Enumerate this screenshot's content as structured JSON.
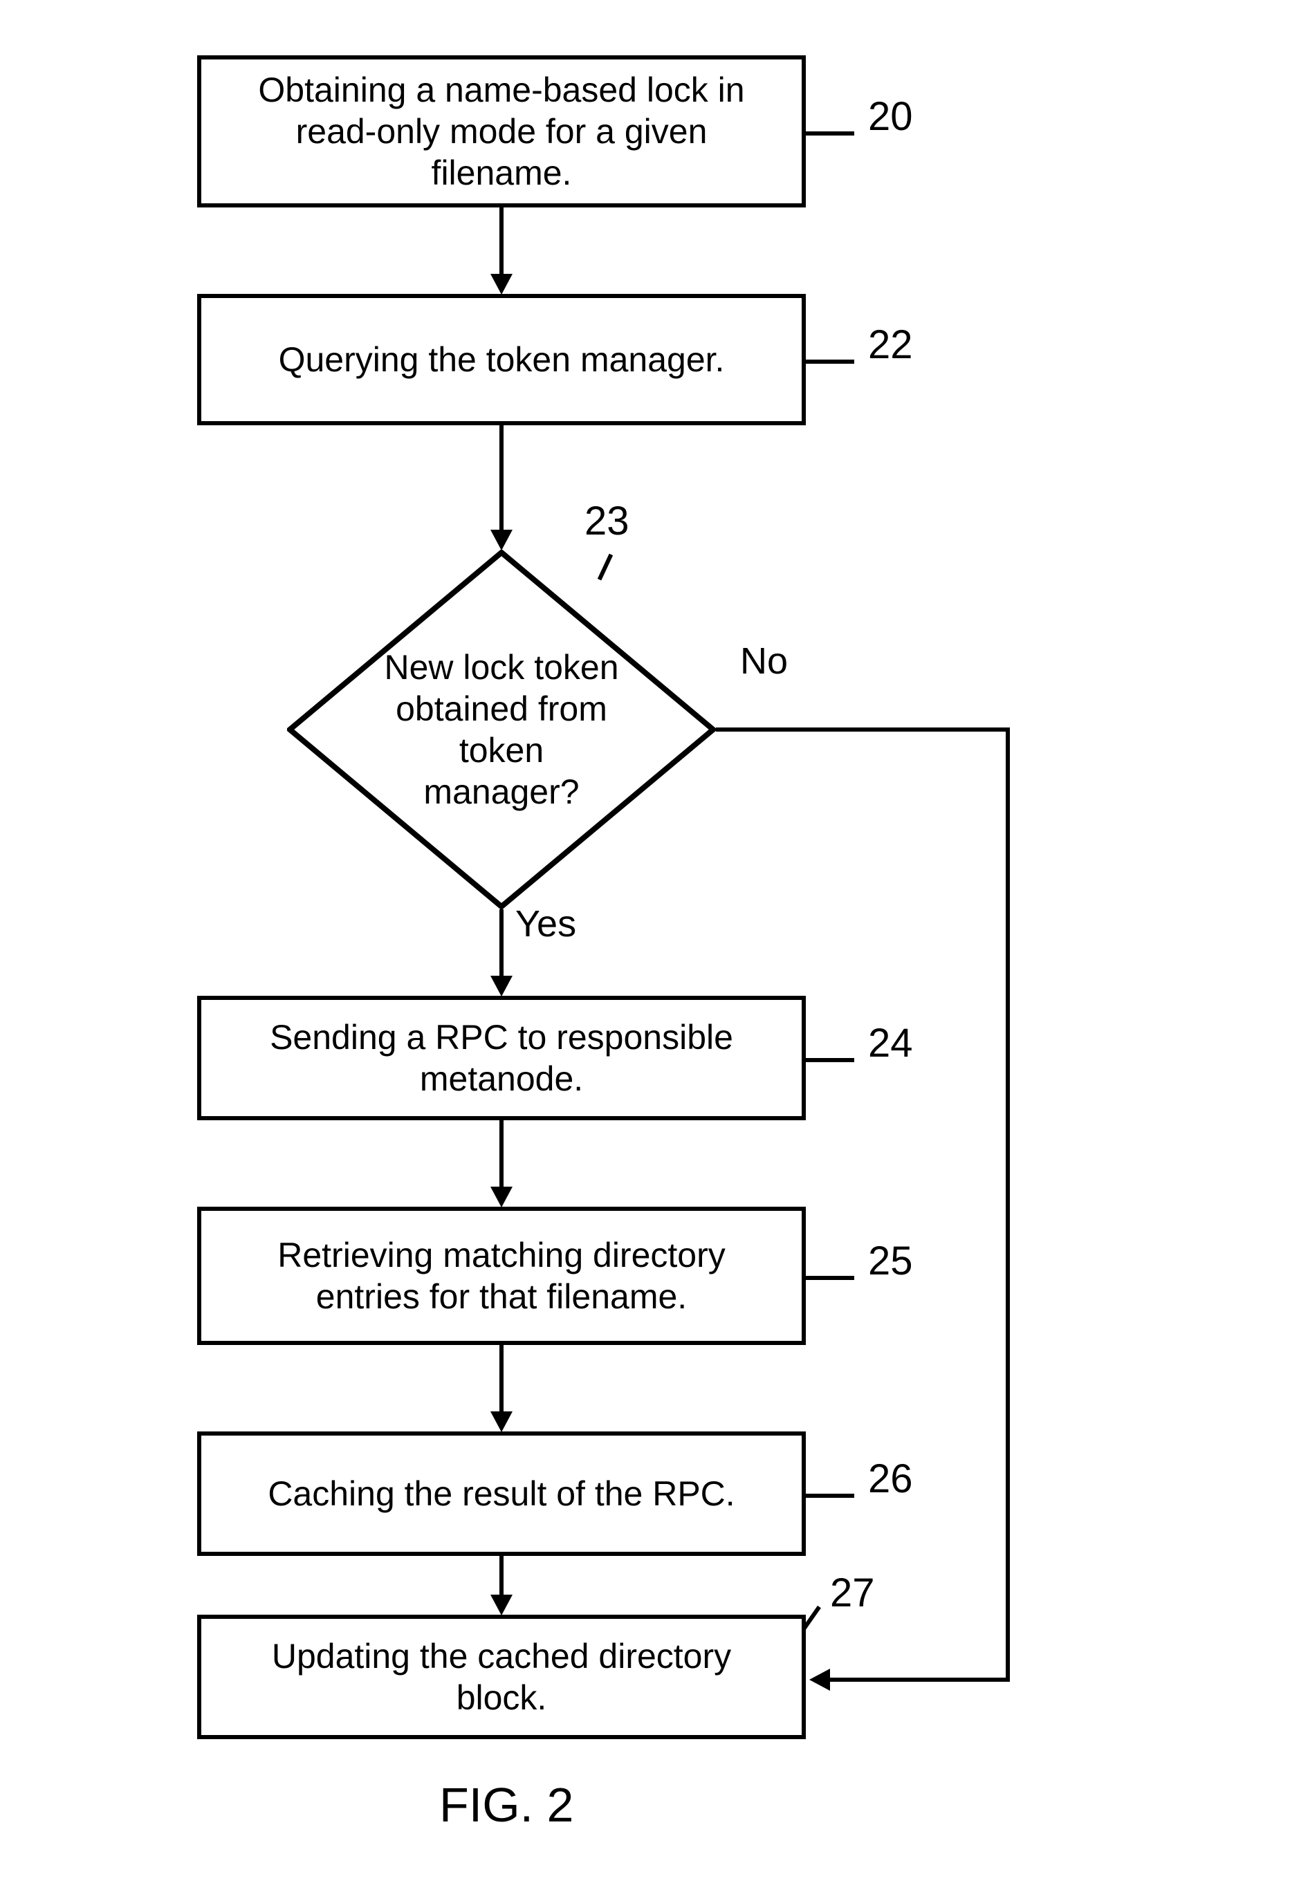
{
  "chart_data": {
    "type": "flowchart",
    "title": "FIG. 2",
    "nodes": [
      {
        "id": 20,
        "type": "process",
        "text": "Obtaining a name-based lock in read-only mode for a given filename."
      },
      {
        "id": 22,
        "type": "process",
        "text": "Querying the token manager."
      },
      {
        "id": 23,
        "type": "decision",
        "text": "New lock token obtained from token manager?"
      },
      {
        "id": 24,
        "type": "process",
        "text": "Sending a RPC to responsible metanode."
      },
      {
        "id": 25,
        "type": "process",
        "text": "Retrieving matching directory entries for that filename."
      },
      {
        "id": 26,
        "type": "process",
        "text": "Caching the result of the RPC."
      },
      {
        "id": 27,
        "type": "process",
        "text": "Updating the cached directory block."
      }
    ],
    "edges": [
      {
        "from": 20,
        "to": 22,
        "label": ""
      },
      {
        "from": 22,
        "to": 23,
        "label": ""
      },
      {
        "from": 23,
        "to": 24,
        "label": "Yes"
      },
      {
        "from": 23,
        "to": 27,
        "label": "No"
      },
      {
        "from": 24,
        "to": 25,
        "label": ""
      },
      {
        "from": 25,
        "to": 26,
        "label": ""
      },
      {
        "from": 26,
        "to": 27,
        "label": ""
      }
    ]
  },
  "labels": {
    "ref20": "20",
    "ref22": "22",
    "ref23": "23",
    "ref24": "24",
    "ref25": "25",
    "ref26": "26",
    "ref27": "27",
    "yes": "Yes",
    "no": "No",
    "figure": "FIG. 2"
  }
}
